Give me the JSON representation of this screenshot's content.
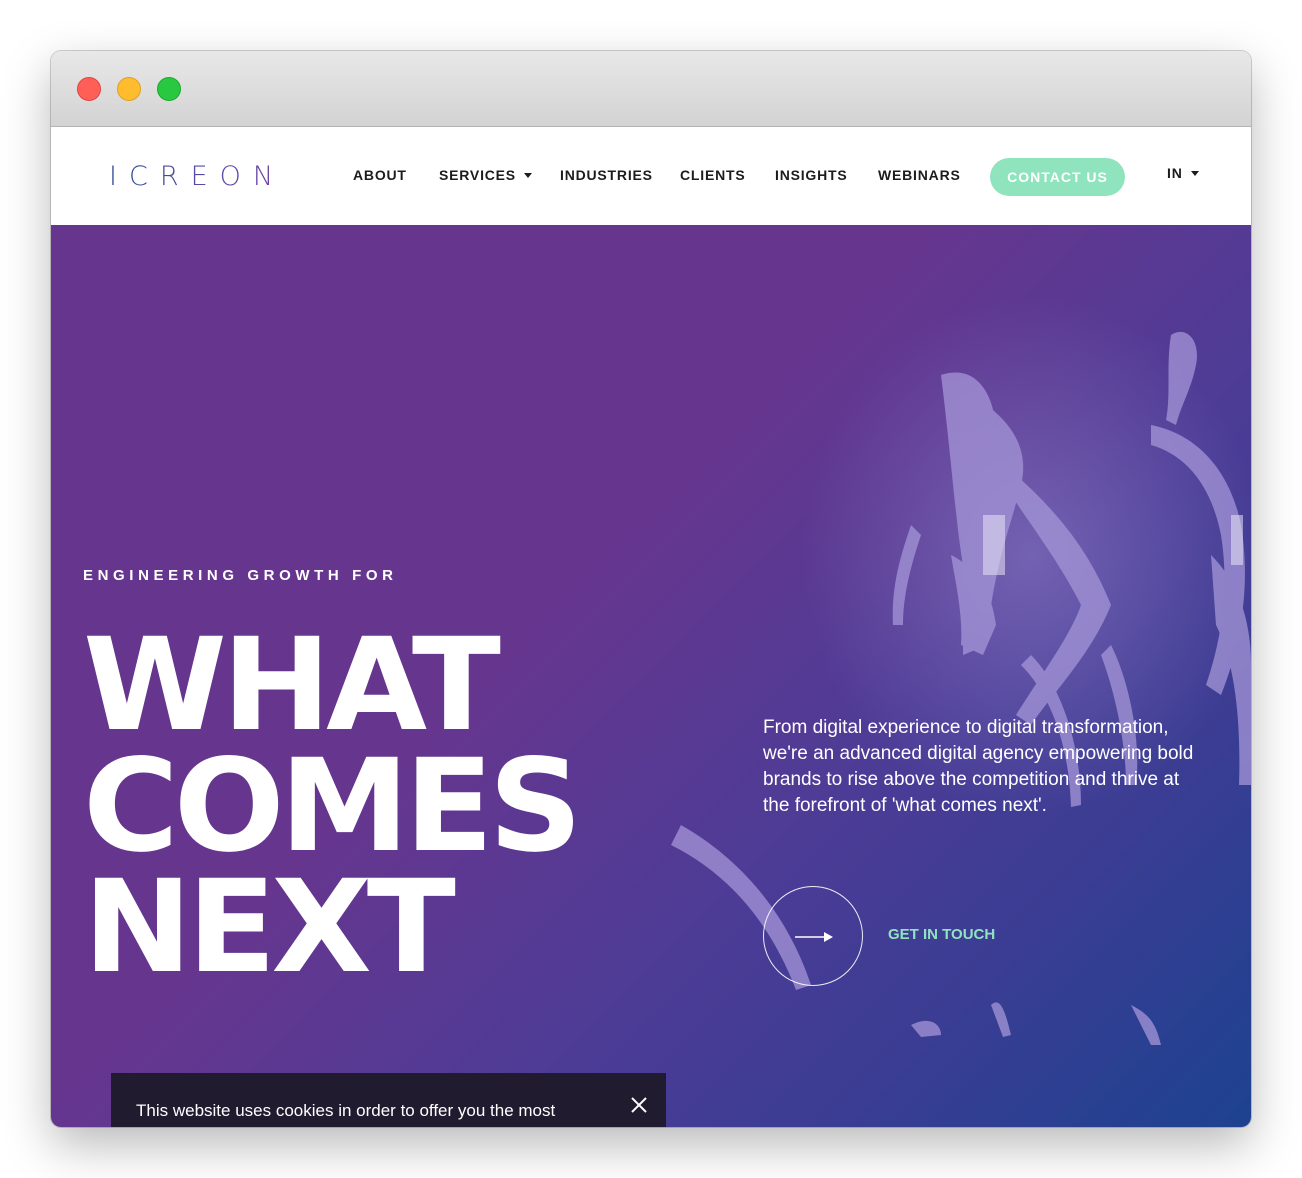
{
  "window": {
    "controls": [
      "close",
      "minimize",
      "maximize"
    ]
  },
  "brand": {
    "logo_text": "ICREON",
    "accent_color": "#8fe4bd",
    "hero_gradient": [
      "#66368f",
      "#1d4290"
    ]
  },
  "nav": {
    "items": [
      {
        "label": "ABOUT",
        "has_dropdown": false
      },
      {
        "label": "SERVICES",
        "has_dropdown": true
      },
      {
        "label": "INDUSTRIES",
        "has_dropdown": false
      },
      {
        "label": "CLIENTS",
        "has_dropdown": false
      },
      {
        "label": "INSIGHTS",
        "has_dropdown": false
      },
      {
        "label": "WEBINARS",
        "has_dropdown": false
      }
    ],
    "contact_label": "CONTACT US",
    "region_label": "IN"
  },
  "hero": {
    "eyebrow": "ENGINEERING GROWTH FOR",
    "headline_lines": [
      "WHAT",
      "COMES",
      "NEXT"
    ],
    "description": "From digital experience to digital transformation, we're an advanced digital agency empowering bold brands to rise above the competition and thrive at the forefront of 'what comes next'.",
    "cta_label": "GET IN TOUCH",
    "cta_icon": "arrow-right-icon",
    "background_image": "runners-icon"
  },
  "cookie_banner": {
    "text": "This website uses cookies in order to offer you the most relevant information. By clicking accept, you consent",
    "close_icon": "close-icon"
  }
}
